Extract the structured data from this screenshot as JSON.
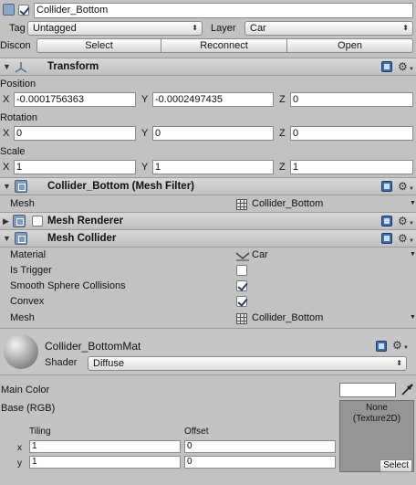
{
  "object": {
    "name": "Collider_Bottom",
    "tag_label": "Tag",
    "tag_value": "Untagged",
    "layer_label": "Layer",
    "layer_value": "Car",
    "prefab_row_label": "Discon",
    "prefab_buttons": [
      "Select",
      "Reconnect",
      "Open"
    ]
  },
  "transform": {
    "title": "Transform",
    "position_label": "Position",
    "rotation_label": "Rotation",
    "scale_label": "Scale",
    "axes": [
      "X",
      "Y",
      "Z"
    ],
    "position": [
      "-0.0001756363",
      "-0.0002497435",
      "0"
    ],
    "rotation": [
      "0",
      "0",
      "0"
    ],
    "scale": [
      "1",
      "1",
      "1"
    ]
  },
  "mesh_filter": {
    "title": "Collider_Bottom (Mesh Filter)",
    "mesh_label": "Mesh",
    "mesh_value": "Collider_Bottom"
  },
  "mesh_renderer": {
    "title": "Mesh Renderer"
  },
  "mesh_collider": {
    "title": "Mesh Collider",
    "material_label": "Material",
    "material_value": "Car",
    "is_trigger_label": "Is Trigger",
    "is_trigger": false,
    "smooth_label": "Smooth Sphere Collisions",
    "smooth": true,
    "convex_label": "Convex",
    "convex": true,
    "mesh_label": "Mesh",
    "mesh_value": "Collider_Bottom"
  },
  "material": {
    "name": "Collider_BottomMat",
    "shader_label": "Shader",
    "shader_value": "Diffuse",
    "main_color_label": "Main Color",
    "base_label": "Base (RGB)",
    "texture_none": "None",
    "texture_type": "(Texture2D)",
    "select_label": "Select",
    "tiling_label": "Tiling",
    "offset_label": "Offset",
    "x_label": "x",
    "y_label": "y",
    "tiling": [
      "1",
      "1"
    ],
    "offset": [
      "0",
      "0"
    ]
  }
}
